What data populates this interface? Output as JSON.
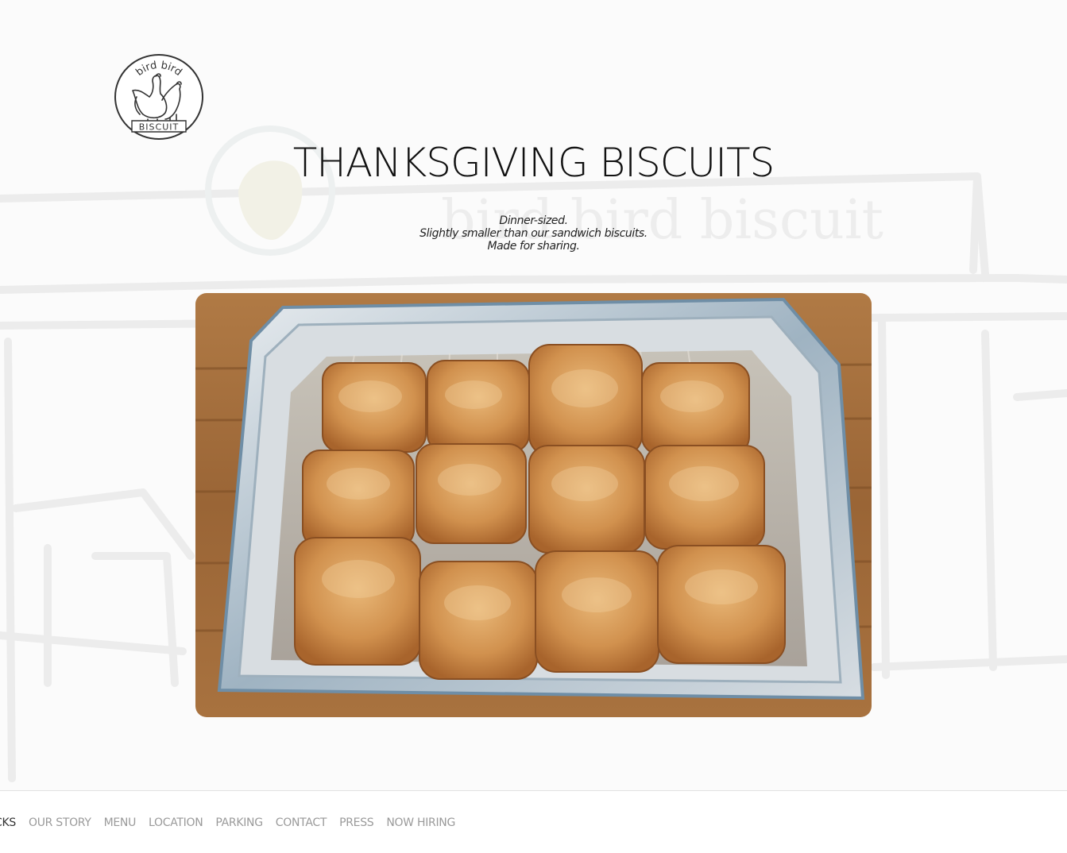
{
  "logo": {
    "top_text": "bird bird",
    "bottom_text": "BISCUIT"
  },
  "hero": {
    "title": "THANKSGIVING BISCUITS",
    "tagline_lines": [
      "Dinner-sized.",
      "Slightly smaller than our sandwich biscuits.",
      "Made for sharing."
    ]
  },
  "background": {
    "sign_text": "bird bird biscuit"
  },
  "footer": {
    "nav_items": [
      "ACKS",
      "OUR STORY",
      "MENU",
      "LOCATION",
      "PARKING",
      "CONTACT",
      "PRESS",
      "NOW HIRING"
    ]
  },
  "colors": {
    "title": "#111111",
    "nav_text": "#9a9a9a",
    "foil": "#b9c2c8",
    "biscuit": "#d49a55",
    "wood": "#9c6a3c"
  }
}
